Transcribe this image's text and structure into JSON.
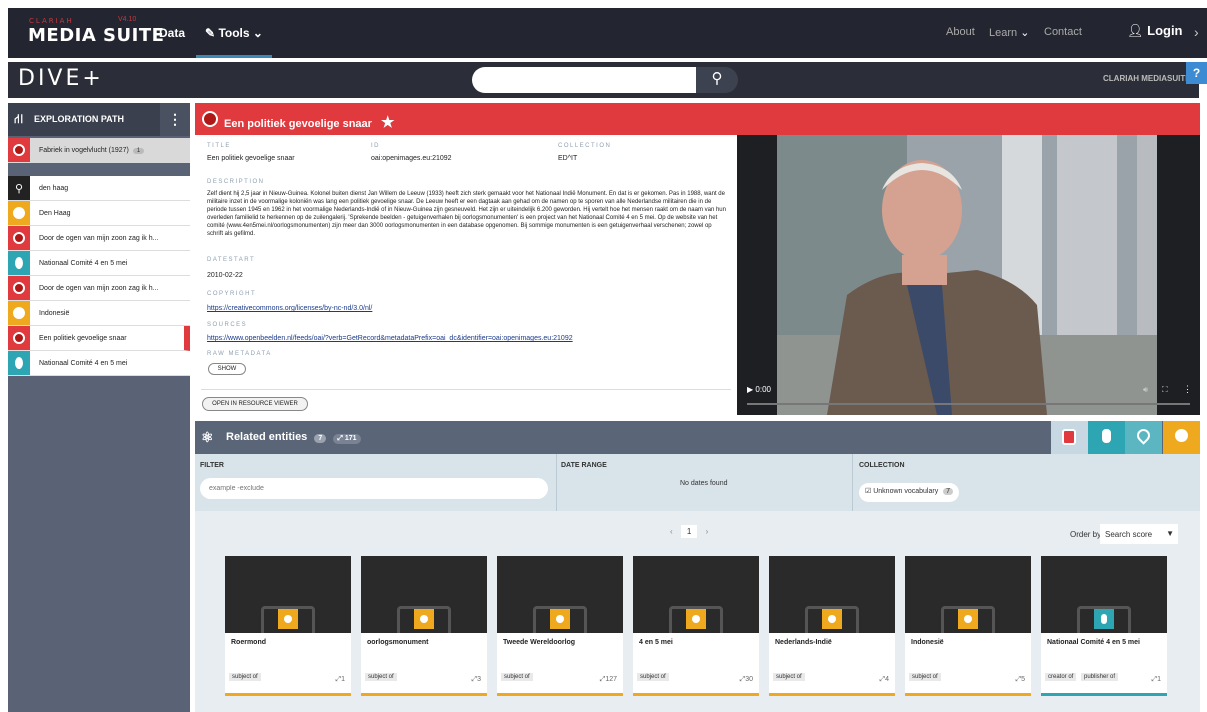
{
  "topbar": {
    "brand_sub": "CLARIAH",
    "brand_version": "V4.10",
    "brand_name": "MEDIA SUITE",
    "nav_data": "Data",
    "nav_tools": "Tools",
    "nav_about": "About",
    "nav_learn": "Learn",
    "nav_contact": "Contact",
    "login": "Login"
  },
  "divebar": {
    "logo": "DIVE+",
    "search_placeholder": "",
    "right_label": "CLARIAH MEDIASUITE",
    "help": "?"
  },
  "sidebar": {
    "title": "EXPLORATION PATH",
    "items": [
      {
        "label": "Fabriek in vogelvlucht (1927)",
        "count": "1",
        "type": "media",
        "color": "#e0393e"
      },
      {
        "label": "den haag",
        "type": "search"
      },
      {
        "label": "Den Haag",
        "type": "concept",
        "color": "#efa91e"
      },
      {
        "label": "Door de ogen van mijn zoon zag ik h...",
        "type": "media",
        "color": "#e0393e"
      },
      {
        "label": "Nationaal Comité 4 en 5 mei",
        "type": "actor",
        "color": "#2ea5b2"
      },
      {
        "label": "Door de ogen van mijn zoon zag ik h...",
        "type": "media",
        "color": "#e0393e"
      },
      {
        "label": "Indonesië",
        "type": "concept",
        "color": "#efa91e"
      },
      {
        "label": "Een politiek gevoelige snaar",
        "type": "media",
        "color": "#e0393e"
      },
      {
        "label": "Nationaal Comité 4 en 5 mei",
        "type": "actor",
        "color": "#2ea5b2"
      }
    ]
  },
  "entity": {
    "title": "Een politiek gevoelige snaar",
    "title_label": "TITLE",
    "title_value": "Een politiek gevoelige snaar",
    "id_label": "ID",
    "id_value": "oai:openimages.eu:21092",
    "collection_label": "COLLECTION",
    "collection_value": "ED^IT",
    "description_label": "DESCRIPTION",
    "description": "Zelf dient hij 2,5 jaar in Nieuw-Guinea. Kolonel buiten dienst Jan Willem de Leeuw (1933) heeft zich sterk gemaakt voor het Nationaal Indië Monument. En dat is er gekomen. Pas in 1988, want de militaire inzet in de voormalige koloniën was lang een politiek gevoelige snaar. De Leeuw heeft er een dagtaak aan gehad om de namen op te sporen van alle Nederlandse militairen die in de periode tussen 1945 en 1962 in het voormalige Nederlands-Indië of in Nieuw-Guinea zijn gesneuveld. Het zijn er uiteindelijk 6.200 geworden. Hij vertelt hoe het mensen raakt om de naam van hun overleden familielid te herkennen op de zuilengalerij. 'Sprekende beelden - getuigenverhalen bij oorlogsmonumenten' is een project van het Nationaal Comité 4 en 5 mei. Op de website van het comité (www.4en5mei.nl/oorlogsmonumenten) zijn meer dan 3000 oorlogsmonumenten in een database opgenomen. Bij sommige monumenten is een getuigenverhaal verschenen; zowel op schrift als gefilmd.",
    "datestart_label": "DATESTART",
    "datestart_value": "2010-02-22",
    "copyright_label": "COPYRIGHT",
    "copyright_value": "https://creativecommons.org/licenses/by-nc-nd/3.0/nl/",
    "sources_label": "SOURCES",
    "sources_value": "https://www.openbeelden.nl/feeds/oai/?verb=GetRecord&metadataPrefix=oai_dc&identifier=oai:openimages.eu:21092",
    "raw_label": "RAW METADATA",
    "show_button": "SHOW",
    "open_button": "OPEN IN RESOURCE VIEWER"
  },
  "video": {
    "time": "0:00"
  },
  "related": {
    "title": "Related entities",
    "count": "7",
    "link_count": "171"
  },
  "filters": {
    "filter_label": "FILTER",
    "filter_placeholder": "example -exclude",
    "date_label": "DATE RANGE",
    "date_value": "No dates found",
    "collection_label": "COLLECTION",
    "collection_option": "Unknown vocabulary",
    "collection_count": "7"
  },
  "results": {
    "page": "1",
    "order_label": "Order by",
    "order_value": "Search score",
    "cards": [
      {
        "name": "Roermond",
        "rel1": "subject of",
        "rel2": "",
        "count": "1",
        "color": "#efa91e"
      },
      {
        "name": "oorlogsmonument",
        "rel1": "subject of",
        "rel2": "",
        "count": "3",
        "color": "#efa91e"
      },
      {
        "name": "Tweede Wereldoorlog",
        "rel1": "subject of",
        "rel2": "",
        "count": "127",
        "color": "#efa91e"
      },
      {
        "name": "4 en 5 mei",
        "rel1": "subject of",
        "rel2": "",
        "count": "30",
        "color": "#efa91e"
      },
      {
        "name": "Nederlands-Indië",
        "rel1": "subject of",
        "rel2": "",
        "count": "4",
        "color": "#efa91e"
      },
      {
        "name": "Indonesië",
        "rel1": "subject of",
        "rel2": "",
        "count": "5",
        "color": "#efa91e"
      },
      {
        "name": "Nationaal Comité 4 en 5 mei",
        "rel1": "creator of",
        "rel2": "publisher of",
        "count": "1",
        "color": "#2ea5b2"
      }
    ]
  }
}
